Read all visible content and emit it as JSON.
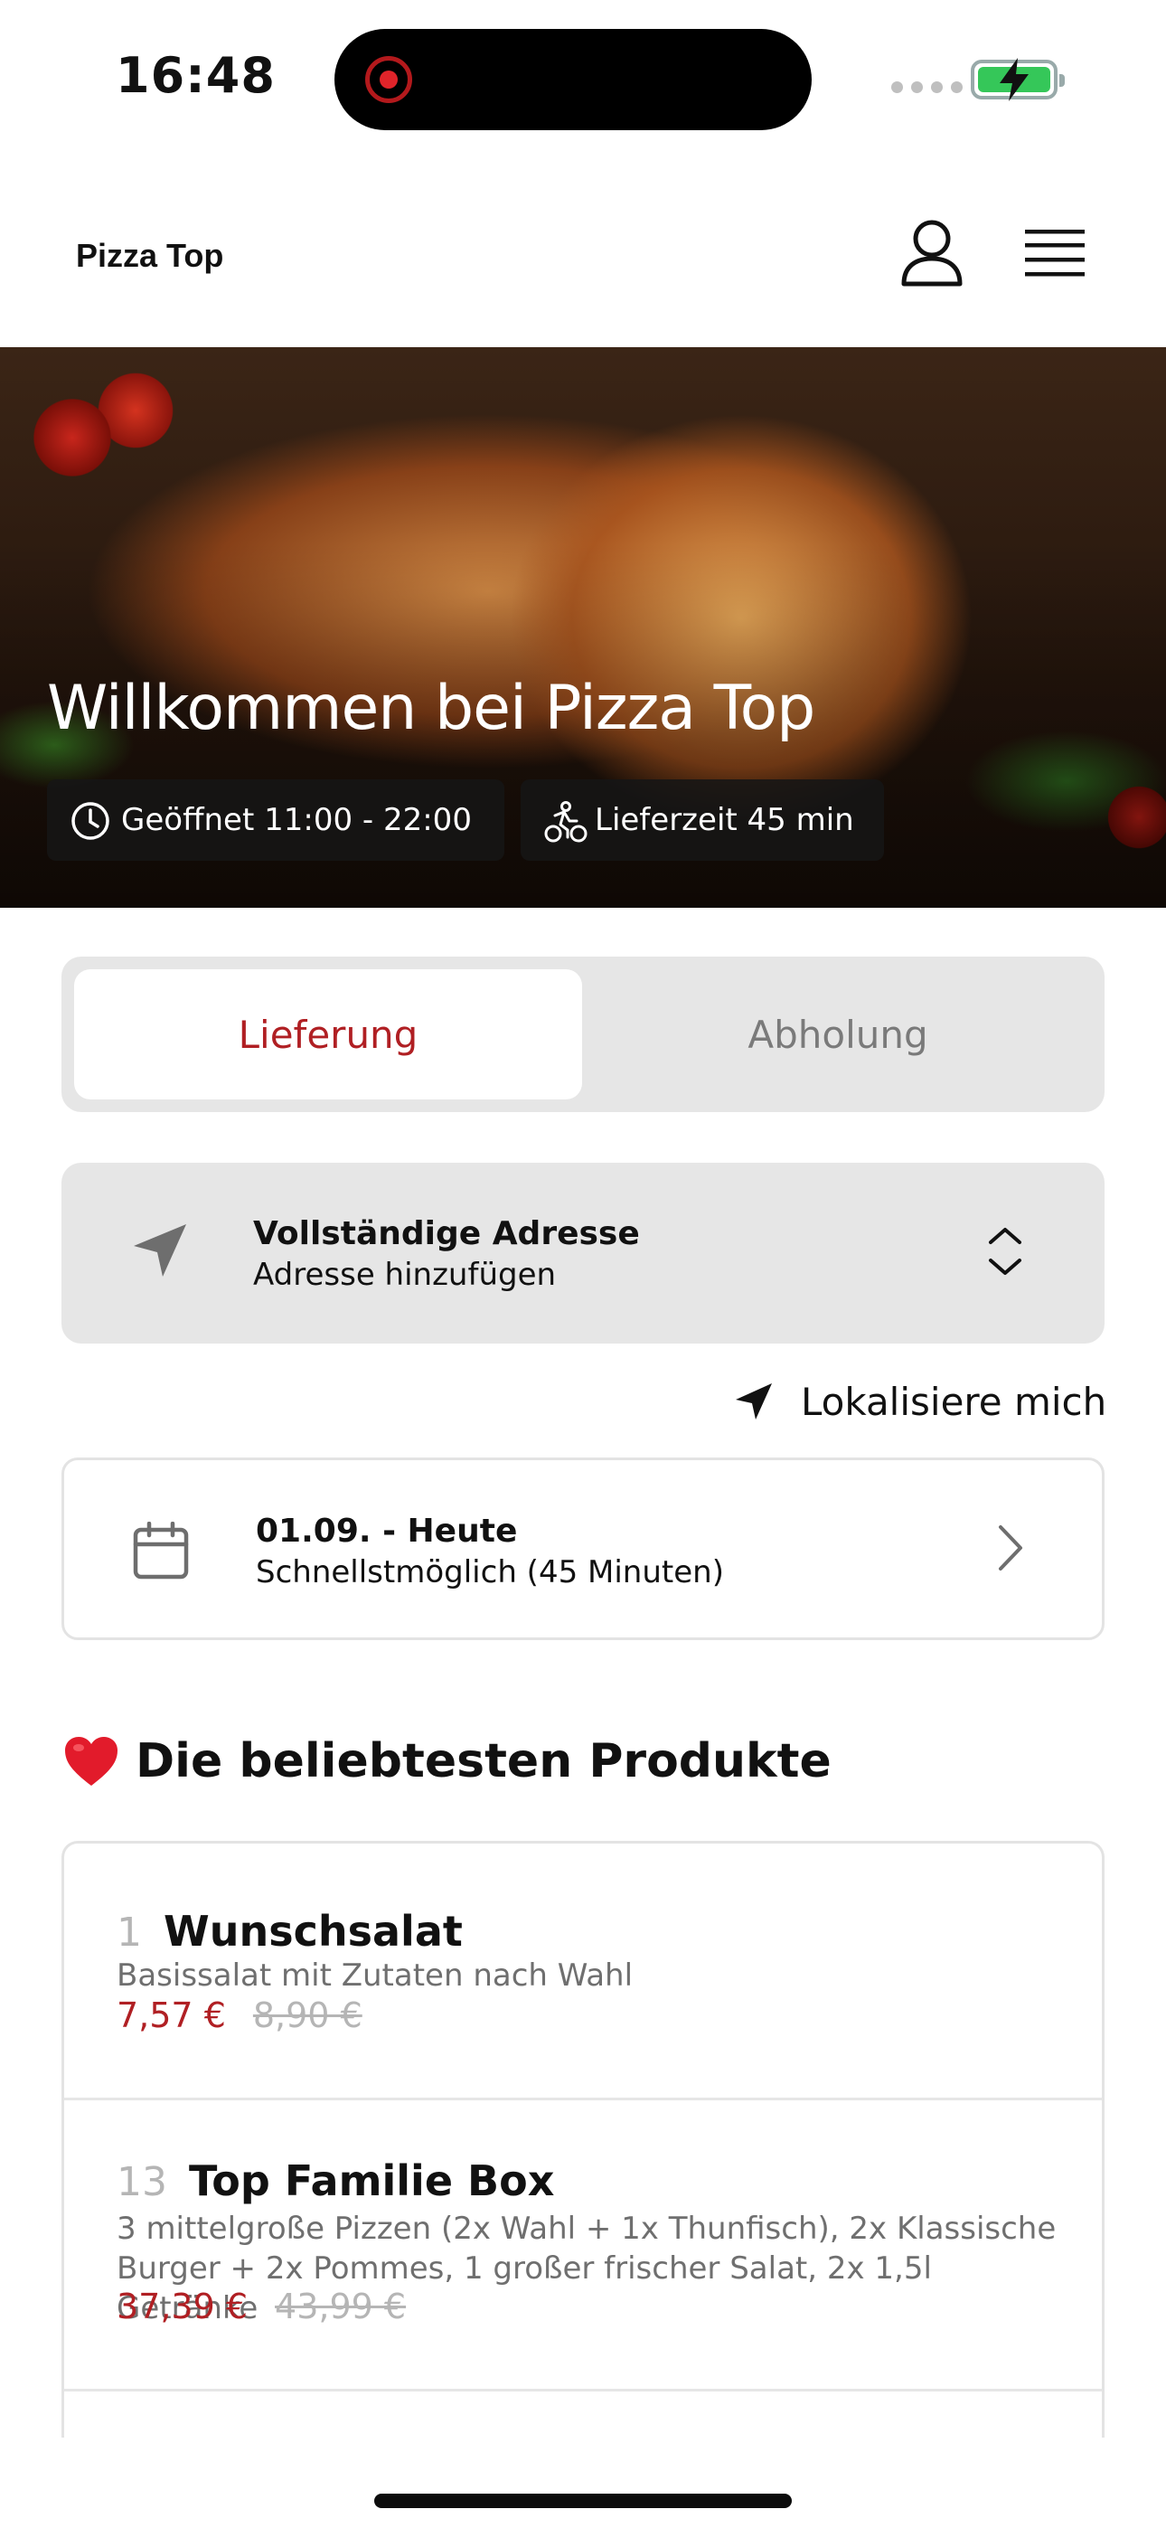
{
  "status_bar": {
    "time": "16:48"
  },
  "header": {
    "brand": "Pizza Top",
    "user_icon": "user-icon",
    "menu_icon": "menu-icon"
  },
  "hero": {
    "title": "Willkommen bei Pizza Top",
    "hours_chip": "Geöffnet 11:00 - 22:00",
    "delivery_chip": "Lieferzeit 45 min"
  },
  "mode_toggle": {
    "delivery": "Lieferung",
    "pickup": "Abholung",
    "selected": "Lieferung"
  },
  "address": {
    "title": "Vollständige Adresse",
    "subtitle": "Adresse hinzufügen",
    "locate": "Lokalisiere mich"
  },
  "schedule": {
    "date": "01.09. - Heute",
    "time": "Schnellstmöglich (45 Minuten)"
  },
  "popular": {
    "title": "Die beliebtesten Produkte",
    "items": [
      {
        "number": "1",
        "name": "Wunschsalat",
        "description": "Basissalat mit Zutaten nach Wahl",
        "price": "7,57 €",
        "old_price": "8,90 €"
      },
      {
        "number": "13",
        "name": "Top Familie Box",
        "description": "3 mittelgroße Pizzen (2x Wahl + 1x Thunfisch), 2x Klassische Burger + 2x Pommes, 1 großer frischer Salat, 2x 1,5l Getränke",
        "price": "37,39 €",
        "old_price": "43,99 €"
      }
    ]
  },
  "colors": {
    "accent": "#b01f23",
    "muted": "#b5b5b5",
    "panel": "#e6e6e6"
  }
}
